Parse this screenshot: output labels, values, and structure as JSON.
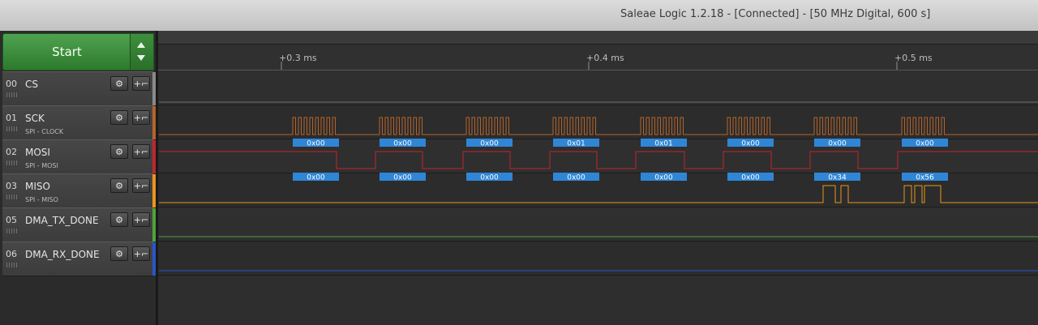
{
  "window": {
    "title": "Saleae Logic 1.2.18 - [Connected] - [50 MHz Digital, 600 s]"
  },
  "sidebar": {
    "start_label": "Start",
    "channels": [
      {
        "num": "00",
        "name": "CS",
        "sub": "",
        "color": "#8a8a8a"
      },
      {
        "num": "01",
        "name": "SCK",
        "sub": "SPI - CLOCK",
        "color": "#b4642a"
      },
      {
        "num": "02",
        "name": "MOSI",
        "sub": "SPI - MOSI",
        "color": "#c0262e"
      },
      {
        "num": "03",
        "name": "MISO",
        "sub": "SPI - MISO",
        "color": "#e8961a"
      },
      {
        "num": "05",
        "name": "DMA_TX_DONE",
        "sub": "",
        "color": "#4fa33a"
      },
      {
        "num": "06",
        "name": "DMA_RX_DONE",
        "sub": "",
        "color": "#2a55c8"
      }
    ]
  },
  "timeline": {
    "ticks": [
      "+0.3 ms",
      "+0.4 ms",
      "+0.5 ms"
    ]
  },
  "decoded": {
    "mosi": [
      "0x00",
      "0x00",
      "0x00",
      "0x01",
      "0x01",
      "0x00",
      "0x00",
      "0x00"
    ],
    "miso": [
      "0x00",
      "0x00",
      "0x00",
      "0x00",
      "0x00",
      "0x00",
      "0x34",
      "0x56"
    ]
  },
  "colors": {
    "cs_trace": "#6e6e6e",
    "sck_trace": "#b4642a",
    "mosi_trace": "#c0262e",
    "miso_trace": "#e8961a",
    "tx_trace": "#4fa33a",
    "rx_trace": "#2a55c8",
    "label_bg": "#2f86d6"
  }
}
